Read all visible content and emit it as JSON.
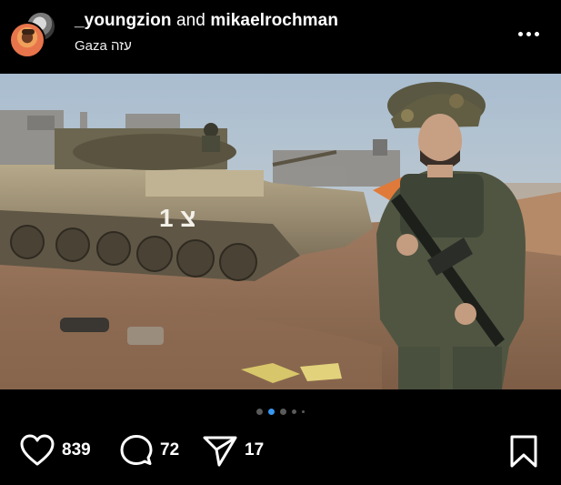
{
  "post": {
    "author_primary": "_youngzion",
    "conjunction": "and",
    "author_secondary": "mikaelrochman",
    "location": "Gaza עזה"
  },
  "carousel": {
    "total_dots": 5,
    "active_index": 1
  },
  "actions": {
    "likes_count": "839",
    "comments_count": "72",
    "shares_count": "17"
  },
  "icons": {
    "like": "heart-icon",
    "comment": "comment-icon",
    "share": "send-icon",
    "save": "bookmark-icon",
    "more": "more-options-icon"
  },
  "colors": {
    "background": "#000000",
    "text": "#ffffff",
    "active_dot": "#3897f0",
    "inactive_dot": "#5a5a5a"
  },
  "photo": {
    "tank_marking": "1 צ"
  }
}
